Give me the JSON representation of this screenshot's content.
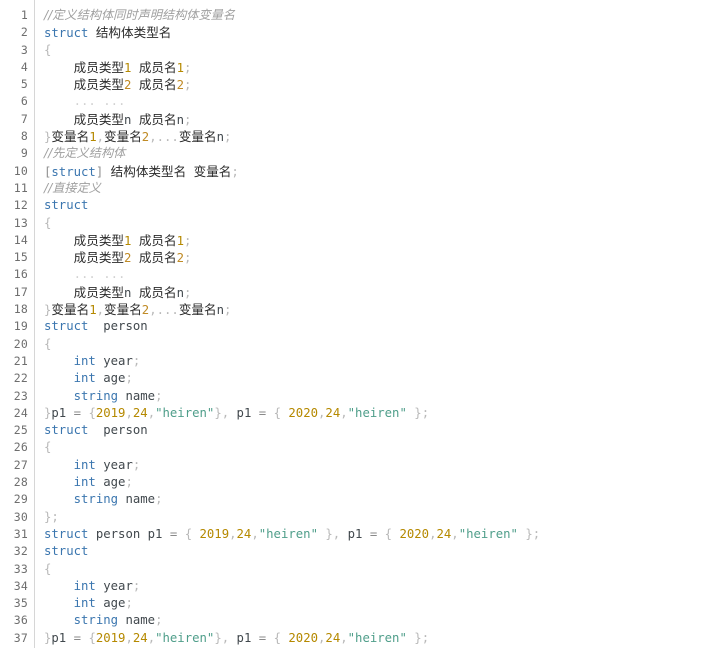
{
  "editor": {
    "name": "code-viewer",
    "language": "C/C++ struct syntax reference",
    "total_lines": 37,
    "colors": {
      "background": "#ffffff",
      "gutter_text": "#6e6e6e",
      "gutter_separator": "#d6d6d6",
      "keyword": "#3b76af",
      "number": "#b58900",
      "string": "#4f9e8a",
      "comment": "#a0a0a0",
      "identifier": "#41484d",
      "punctuation": "#b9b9b9",
      "cjk_text": "#2b2b2b"
    }
  },
  "gutter": {
    "numbers": [
      "1",
      "2",
      "3",
      "4",
      "5",
      "6",
      "7",
      "8",
      "9",
      "10",
      "11",
      "12",
      "13",
      "14",
      "15",
      "16",
      "17",
      "18",
      "19",
      "20",
      "21",
      "22",
      "23",
      "24",
      "25",
      "26",
      "27",
      "28",
      "29",
      "30",
      "31",
      "32",
      "33",
      "34",
      "35",
      "36",
      "37"
    ]
  },
  "lines": [
    {
      "n": 1,
      "text": "//定义结构体同时声明结构体变量名",
      "tokens": [
        {
          "t": "//定义结构体同时声明结构体变量名",
          "c": "comment"
        }
      ]
    },
    {
      "n": 2,
      "text": "struct 结构体类型名",
      "tokens": [
        {
          "t": "struct",
          "c": "kw"
        },
        {
          "t": " ",
          "c": "plain"
        },
        {
          "t": "结构体类型名",
          "c": "cjk"
        }
      ]
    },
    {
      "n": 3,
      "text": "{",
      "tokens": [
        {
          "t": "{",
          "c": "punct"
        }
      ]
    },
    {
      "n": 4,
      "text": "    成员类型1 成员名1;",
      "tokens": [
        {
          "t": "    ",
          "c": "plain"
        },
        {
          "t": "成员类型",
          "c": "cjk"
        },
        {
          "t": "1",
          "c": "num"
        },
        {
          "t": " ",
          "c": "plain"
        },
        {
          "t": "成员名",
          "c": "cjk"
        },
        {
          "t": "1",
          "c": "num"
        },
        {
          "t": ";",
          "c": "punct"
        }
      ]
    },
    {
      "n": 5,
      "text": "    成员类型2 成员名2;",
      "tokens": [
        {
          "t": "    ",
          "c": "plain"
        },
        {
          "t": "成员类型",
          "c": "cjk"
        },
        {
          "t": "2",
          "c": "num2"
        },
        {
          "t": " ",
          "c": "plain"
        },
        {
          "t": "成员名",
          "c": "cjk"
        },
        {
          "t": "2",
          "c": "num2"
        },
        {
          "t": ";",
          "c": "punct"
        }
      ]
    },
    {
      "n": 6,
      "text": "    ... ...",
      "tokens": [
        {
          "t": "    ",
          "c": "plain"
        },
        {
          "t": "... ...",
          "c": "dots"
        }
      ]
    },
    {
      "n": 7,
      "text": "    成员类型n 成员名n;",
      "tokens": [
        {
          "t": "    ",
          "c": "plain"
        },
        {
          "t": "成员类型",
          "c": "cjk"
        },
        {
          "t": "n",
          "c": "ident"
        },
        {
          "t": " ",
          "c": "plain"
        },
        {
          "t": "成员名",
          "c": "cjk"
        },
        {
          "t": "n",
          "c": "ident"
        },
        {
          "t": ";",
          "c": "punct"
        }
      ]
    },
    {
      "n": 8,
      "text": "}变量名1,变量名2,...变量名n;",
      "tokens": [
        {
          "t": "}",
          "c": "punct"
        },
        {
          "t": "变量名",
          "c": "cjk"
        },
        {
          "t": "1",
          "c": "num"
        },
        {
          "t": ",",
          "c": "punct"
        },
        {
          "t": "变量名",
          "c": "cjk"
        },
        {
          "t": "2",
          "c": "num2"
        },
        {
          "t": ",",
          "c": "punct"
        },
        {
          "t": "...",
          "c": "punct"
        },
        {
          "t": "变量名",
          "c": "cjk"
        },
        {
          "t": "n",
          "c": "ident"
        },
        {
          "t": ";",
          "c": "punct"
        }
      ]
    },
    {
      "n": 9,
      "text": "//先定义结构体",
      "tokens": [
        {
          "t": "//先定义结构体",
          "c": "comment"
        }
      ]
    },
    {
      "n": 10,
      "text": "[struct] 结构体类型名 变量名;",
      "tokens": [
        {
          "t": "[",
          "c": "punct-d"
        },
        {
          "t": "struct",
          "c": "kw"
        },
        {
          "t": "]",
          "c": "punct-d"
        },
        {
          "t": " ",
          "c": "plain"
        },
        {
          "t": "结构体类型名",
          "c": "cjk"
        },
        {
          "t": " ",
          "c": "plain"
        },
        {
          "t": "变量名",
          "c": "cjk"
        },
        {
          "t": ";",
          "c": "punct"
        }
      ]
    },
    {
      "n": 11,
      "text": "//直接定义",
      "tokens": [
        {
          "t": "//直接定义",
          "c": "comment"
        }
      ]
    },
    {
      "n": 12,
      "text": "struct",
      "tokens": [
        {
          "t": "struct",
          "c": "kw"
        }
      ]
    },
    {
      "n": 13,
      "text": "{",
      "tokens": [
        {
          "t": "{",
          "c": "punct"
        }
      ]
    },
    {
      "n": 14,
      "text": "    成员类型1 成员名1;",
      "tokens": [
        {
          "t": "    ",
          "c": "plain"
        },
        {
          "t": "成员类型",
          "c": "cjk"
        },
        {
          "t": "1",
          "c": "num"
        },
        {
          "t": " ",
          "c": "plain"
        },
        {
          "t": "成员名",
          "c": "cjk"
        },
        {
          "t": "1",
          "c": "num"
        },
        {
          "t": ";",
          "c": "punct"
        }
      ]
    },
    {
      "n": 15,
      "text": "    成员类型2 成员名2;",
      "tokens": [
        {
          "t": "    ",
          "c": "plain"
        },
        {
          "t": "成员类型",
          "c": "cjk"
        },
        {
          "t": "2",
          "c": "num2"
        },
        {
          "t": " ",
          "c": "plain"
        },
        {
          "t": "成员名",
          "c": "cjk"
        },
        {
          "t": "2",
          "c": "num2"
        },
        {
          "t": ";",
          "c": "punct"
        }
      ]
    },
    {
      "n": 16,
      "text": "    ... ...",
      "tokens": [
        {
          "t": "    ",
          "c": "plain"
        },
        {
          "t": "... ...",
          "c": "dots"
        }
      ]
    },
    {
      "n": 17,
      "text": "    成员类型n 成员名n;",
      "tokens": [
        {
          "t": "    ",
          "c": "plain"
        },
        {
          "t": "成员类型",
          "c": "cjk"
        },
        {
          "t": "n",
          "c": "ident"
        },
        {
          "t": " ",
          "c": "plain"
        },
        {
          "t": "成员名",
          "c": "cjk"
        },
        {
          "t": "n",
          "c": "ident"
        },
        {
          "t": ";",
          "c": "punct"
        }
      ]
    },
    {
      "n": 18,
      "text": "}变量名1,变量名2,...变量名n;",
      "tokens": [
        {
          "t": "}",
          "c": "punct"
        },
        {
          "t": "变量名",
          "c": "cjk"
        },
        {
          "t": "1",
          "c": "num"
        },
        {
          "t": ",",
          "c": "punct"
        },
        {
          "t": "变量名",
          "c": "cjk"
        },
        {
          "t": "2",
          "c": "num2"
        },
        {
          "t": ",",
          "c": "punct"
        },
        {
          "t": "...",
          "c": "punct"
        },
        {
          "t": "变量名",
          "c": "cjk"
        },
        {
          "t": "n",
          "c": "ident"
        },
        {
          "t": ";",
          "c": "punct"
        }
      ]
    },
    {
      "n": 19,
      "text": "struct  person",
      "tokens": [
        {
          "t": "struct",
          "c": "kw"
        },
        {
          "t": "  ",
          "c": "plain"
        },
        {
          "t": "person",
          "c": "ident"
        }
      ]
    },
    {
      "n": 20,
      "text": "{",
      "tokens": [
        {
          "t": "{",
          "c": "punct"
        }
      ]
    },
    {
      "n": 21,
      "text": "    int year;",
      "tokens": [
        {
          "t": "    ",
          "c": "plain"
        },
        {
          "t": "int",
          "c": "kw"
        },
        {
          "t": " ",
          "c": "plain"
        },
        {
          "t": "year",
          "c": "ident"
        },
        {
          "t": ";",
          "c": "punct"
        }
      ]
    },
    {
      "n": 22,
      "text": "    int age;",
      "tokens": [
        {
          "t": "    ",
          "c": "plain"
        },
        {
          "t": "int",
          "c": "kw"
        },
        {
          "t": " ",
          "c": "plain"
        },
        {
          "t": "age",
          "c": "ident"
        },
        {
          "t": ";",
          "c": "punct"
        }
      ]
    },
    {
      "n": 23,
      "text": "    string name;",
      "tokens": [
        {
          "t": "    ",
          "c": "plain"
        },
        {
          "t": "string",
          "c": "kw"
        },
        {
          "t": " ",
          "c": "plain"
        },
        {
          "t": "name",
          "c": "ident"
        },
        {
          "t": ";",
          "c": "punct"
        }
      ]
    },
    {
      "n": 24,
      "text": "}p1 = {2019,24,\"heiren\"}, p1 = { 2020,24,\"heiren\" };",
      "tokens": [
        {
          "t": "}",
          "c": "punct"
        },
        {
          "t": "p1",
          "c": "ident"
        },
        {
          "t": " ",
          "c": "plain"
        },
        {
          "t": "=",
          "c": "op"
        },
        {
          "t": " ",
          "c": "plain"
        },
        {
          "t": "{",
          "c": "punct"
        },
        {
          "t": "2019",
          "c": "num"
        },
        {
          "t": ",",
          "c": "punct"
        },
        {
          "t": "24",
          "c": "num"
        },
        {
          "t": ",",
          "c": "punct"
        },
        {
          "t": "\"heiren\"",
          "c": "str"
        },
        {
          "t": "}",
          "c": "punct"
        },
        {
          "t": ",",
          "c": "punct"
        },
        {
          "t": " ",
          "c": "plain"
        },
        {
          "t": "p1",
          "c": "ident"
        },
        {
          "t": " ",
          "c": "plain"
        },
        {
          "t": "=",
          "c": "op"
        },
        {
          "t": " ",
          "c": "plain"
        },
        {
          "t": "{",
          "c": "punct"
        },
        {
          "t": " ",
          "c": "plain"
        },
        {
          "t": "2020",
          "c": "num"
        },
        {
          "t": ",",
          "c": "punct"
        },
        {
          "t": "24",
          "c": "num"
        },
        {
          "t": ",",
          "c": "punct"
        },
        {
          "t": "\"heiren\"",
          "c": "str"
        },
        {
          "t": " ",
          "c": "plain"
        },
        {
          "t": "}",
          "c": "punct"
        },
        {
          "t": ";",
          "c": "punct"
        }
      ]
    },
    {
      "n": 25,
      "text": "struct  person",
      "tokens": [
        {
          "t": "struct",
          "c": "kw"
        },
        {
          "t": "  ",
          "c": "plain"
        },
        {
          "t": "person",
          "c": "ident"
        }
      ]
    },
    {
      "n": 26,
      "text": "{",
      "tokens": [
        {
          "t": "{",
          "c": "punct"
        }
      ]
    },
    {
      "n": 27,
      "text": "    int year;",
      "tokens": [
        {
          "t": "    ",
          "c": "plain"
        },
        {
          "t": "int",
          "c": "kw"
        },
        {
          "t": " ",
          "c": "plain"
        },
        {
          "t": "year",
          "c": "ident"
        },
        {
          "t": ";",
          "c": "punct"
        }
      ]
    },
    {
      "n": 28,
      "text": "    int age;",
      "tokens": [
        {
          "t": "    ",
          "c": "plain"
        },
        {
          "t": "int",
          "c": "kw"
        },
        {
          "t": " ",
          "c": "plain"
        },
        {
          "t": "age",
          "c": "ident"
        },
        {
          "t": ";",
          "c": "punct"
        }
      ]
    },
    {
      "n": 29,
      "text": "    string name;",
      "tokens": [
        {
          "t": "    ",
          "c": "plain"
        },
        {
          "t": "string",
          "c": "kw"
        },
        {
          "t": " ",
          "c": "plain"
        },
        {
          "t": "name",
          "c": "ident"
        },
        {
          "t": ";",
          "c": "punct"
        }
      ]
    },
    {
      "n": 30,
      "text": "};",
      "tokens": [
        {
          "t": "};",
          "c": "punct"
        }
      ]
    },
    {
      "n": 31,
      "text": "struct person p1 = { 2019,24,\"heiren\" }, p1 = { 2020,24,\"heiren\" };",
      "tokens": [
        {
          "t": "struct",
          "c": "kw"
        },
        {
          "t": " ",
          "c": "plain"
        },
        {
          "t": "person",
          "c": "ident"
        },
        {
          "t": " ",
          "c": "plain"
        },
        {
          "t": "p1",
          "c": "ident"
        },
        {
          "t": " ",
          "c": "plain"
        },
        {
          "t": "=",
          "c": "op"
        },
        {
          "t": " ",
          "c": "plain"
        },
        {
          "t": "{",
          "c": "punct"
        },
        {
          "t": " ",
          "c": "plain"
        },
        {
          "t": "2019",
          "c": "num"
        },
        {
          "t": ",",
          "c": "punct"
        },
        {
          "t": "24",
          "c": "num"
        },
        {
          "t": ",",
          "c": "punct"
        },
        {
          "t": "\"heiren\"",
          "c": "str"
        },
        {
          "t": " ",
          "c": "plain"
        },
        {
          "t": "}",
          "c": "punct"
        },
        {
          "t": ",",
          "c": "punct"
        },
        {
          "t": " ",
          "c": "plain"
        },
        {
          "t": "p1",
          "c": "ident"
        },
        {
          "t": " ",
          "c": "plain"
        },
        {
          "t": "=",
          "c": "op"
        },
        {
          "t": " ",
          "c": "plain"
        },
        {
          "t": "{",
          "c": "punct"
        },
        {
          "t": " ",
          "c": "plain"
        },
        {
          "t": "2020",
          "c": "num"
        },
        {
          "t": ",",
          "c": "punct"
        },
        {
          "t": "24",
          "c": "num"
        },
        {
          "t": ",",
          "c": "punct"
        },
        {
          "t": "\"heiren\"",
          "c": "str"
        },
        {
          "t": " ",
          "c": "plain"
        },
        {
          "t": "}",
          "c": "punct"
        },
        {
          "t": ";",
          "c": "punct"
        }
      ]
    },
    {
      "n": 32,
      "text": "struct",
      "tokens": [
        {
          "t": "struct",
          "c": "kw"
        }
      ]
    },
    {
      "n": 33,
      "text": "{",
      "tokens": [
        {
          "t": "{",
          "c": "punct"
        }
      ]
    },
    {
      "n": 34,
      "text": "    int year;",
      "tokens": [
        {
          "t": "    ",
          "c": "plain"
        },
        {
          "t": "int",
          "c": "kw"
        },
        {
          "t": " ",
          "c": "plain"
        },
        {
          "t": "year",
          "c": "ident"
        },
        {
          "t": ";",
          "c": "punct"
        }
      ]
    },
    {
      "n": 35,
      "text": "    int age;",
      "tokens": [
        {
          "t": "    ",
          "c": "plain"
        },
        {
          "t": "int",
          "c": "kw"
        },
        {
          "t": " ",
          "c": "plain"
        },
        {
          "t": "age",
          "c": "ident"
        },
        {
          "t": ";",
          "c": "punct"
        }
      ]
    },
    {
      "n": 36,
      "text": "    string name;",
      "tokens": [
        {
          "t": "    ",
          "c": "plain"
        },
        {
          "t": "string",
          "c": "kw"
        },
        {
          "t": " ",
          "c": "plain"
        },
        {
          "t": "name",
          "c": "ident"
        },
        {
          "t": ";",
          "c": "punct"
        }
      ]
    },
    {
      "n": 37,
      "text": "}p1 = {2019,24,\"heiren\"}, p1 = { 2020,24,\"heiren\" };",
      "tokens": [
        {
          "t": "}",
          "c": "punct"
        },
        {
          "t": "p1",
          "c": "ident"
        },
        {
          "t": " ",
          "c": "plain"
        },
        {
          "t": "=",
          "c": "op"
        },
        {
          "t": " ",
          "c": "plain"
        },
        {
          "t": "{",
          "c": "punct"
        },
        {
          "t": "2019",
          "c": "num"
        },
        {
          "t": ",",
          "c": "punct"
        },
        {
          "t": "24",
          "c": "num"
        },
        {
          "t": ",",
          "c": "punct"
        },
        {
          "t": "\"heiren\"",
          "c": "str"
        },
        {
          "t": "}",
          "c": "punct"
        },
        {
          "t": ",",
          "c": "punct"
        },
        {
          "t": " ",
          "c": "plain"
        },
        {
          "t": "p1",
          "c": "ident"
        },
        {
          "t": " ",
          "c": "plain"
        },
        {
          "t": "=",
          "c": "op"
        },
        {
          "t": " ",
          "c": "plain"
        },
        {
          "t": "{",
          "c": "punct"
        },
        {
          "t": " ",
          "c": "plain"
        },
        {
          "t": "2020",
          "c": "num"
        },
        {
          "t": ",",
          "c": "punct"
        },
        {
          "t": "24",
          "c": "num"
        },
        {
          "t": ",",
          "c": "punct"
        },
        {
          "t": "\"heiren\"",
          "c": "str"
        },
        {
          "t": " ",
          "c": "plain"
        },
        {
          "t": "}",
          "c": "punct"
        },
        {
          "t": ";",
          "c": "punct"
        }
      ]
    }
  ]
}
